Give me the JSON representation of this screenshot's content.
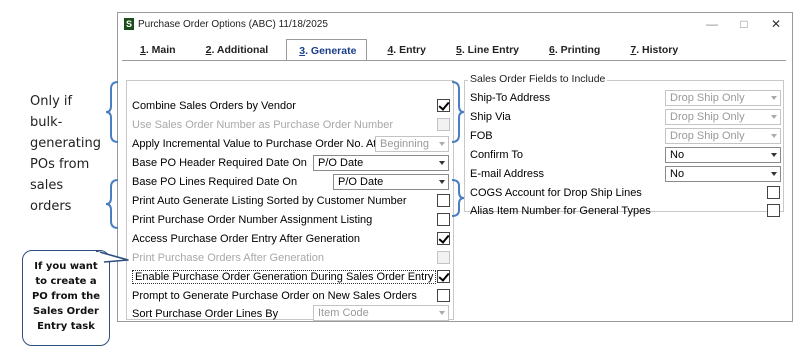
{
  "window": {
    "title": "Purchase Order Options (ABC) 11/18/2025",
    "app_icon": "S",
    "controls": {
      "minimize": "—",
      "maximize": "□",
      "close": "✕"
    }
  },
  "tabs": [
    {
      "num": "1",
      "label": ". Main",
      "active": false
    },
    {
      "num": "2",
      "label": ". Additional",
      "active": false
    },
    {
      "num": "3",
      "label": ". Generate",
      "active": true
    },
    {
      "num": "4",
      "label": ". Entry",
      "active": false
    },
    {
      "num": "5",
      "label": ". Line Entry",
      "active": false
    },
    {
      "num": "6",
      "label": ". Printing",
      "active": false
    },
    {
      "num": "7",
      "label": ". History",
      "active": false
    }
  ],
  "generate": {
    "combine": {
      "label": "Combine Sales Orders by Vendor",
      "checked": true
    },
    "use_so_number": {
      "label": "Use Sales Order Number as Purchase Order Number",
      "checked": false,
      "disabled": true
    },
    "incremental": {
      "label": "Apply Incremental Value to Purchase Order No. At",
      "value": "Beginning"
    },
    "header_date": {
      "label": "Base PO Header Required Date On",
      "value": "P/O Date"
    },
    "lines_date": {
      "label": "Base PO Lines Required Date On",
      "value": "P/O Date"
    },
    "print_auto": {
      "label": "Print Auto Generate Listing Sorted by Customer Number",
      "checked": false
    },
    "print_assign": {
      "label": "Print Purchase Order Number Assignment Listing",
      "checked": false
    },
    "access_entry": {
      "label": "Access Purchase Order Entry After Generation",
      "checked": true
    },
    "print_after": {
      "label": "Print Purchase Orders After Generation",
      "checked": false,
      "disabled": true
    },
    "enable_so_entry": {
      "label": "Enable Purchase Order Generation During Sales Order Entry",
      "checked": true
    },
    "prompt_new": {
      "label": "Prompt to Generate Purchase Order on New Sales Orders",
      "checked": false
    },
    "sort_lines": {
      "label": "Sort Purchase Order Lines By",
      "value": "Item Code"
    }
  },
  "so_fields": {
    "group_label": "Sales Order Fields to Include",
    "ship_to": {
      "label": "Ship-To Address",
      "value": "Drop Ship Only"
    },
    "ship_via": {
      "label": "Ship Via",
      "value": "Drop Ship Only"
    },
    "fob": {
      "label": "FOB",
      "value": "Drop Ship Only"
    },
    "confirm_to": {
      "label": "Confirm To",
      "value": "No"
    },
    "email": {
      "label": "E-mail Address",
      "value": "No"
    },
    "cogs": {
      "label": "COGS Account for Drop Ship Lines",
      "checked": false
    },
    "alias": {
      "label": "Alias Item Number for General Types",
      "checked": false
    }
  },
  "annotations": {
    "note_lines": [
      "Only if",
      "bulk-",
      "generating",
      "POs from",
      "sales",
      "orders"
    ],
    "callout_lines": [
      "If you want",
      "to create a",
      "PO from the",
      "Sales Order",
      "Entry task"
    ],
    "color": "#4a7ec0"
  }
}
